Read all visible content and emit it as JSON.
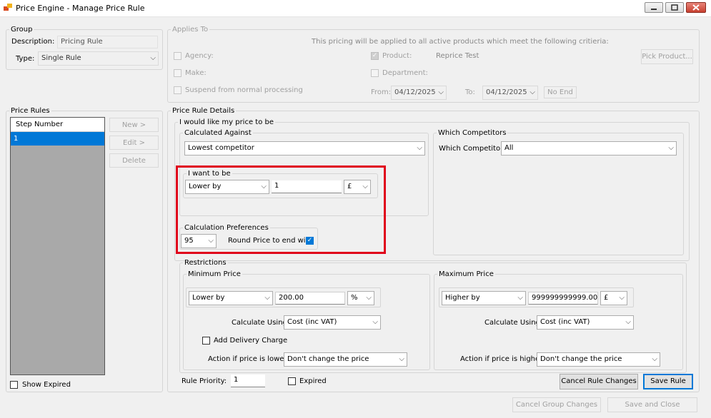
{
  "window": {
    "title": "Price Engine - Manage Price Rule",
    "controls": {
      "minimize": "▭",
      "maximize": "□",
      "close": "✕"
    }
  },
  "group": {
    "legend": "Group",
    "description_label": "Description:",
    "description_value": "Pricing Rule",
    "type_label": "Type:",
    "type_value": "Single Rule"
  },
  "applies_to": {
    "legend": "Applies To",
    "info": "This pricing will be applied to all active products which meet the following critieria:",
    "agency_label": "Agency:",
    "make_label": "Make:",
    "suspend_label": "Suspend from normal processing",
    "product_label": "Product:",
    "product_value": "Reprice Test",
    "pick_product_label": "Pick Product...",
    "department_label": "Department:",
    "from_label": "From:",
    "from_value": "04/12/2025",
    "to_label": "To:",
    "to_value": "04/12/2025",
    "no_end_label": "No End"
  },
  "price_rules": {
    "legend": "Price Rules",
    "column_header": "Step Number",
    "rows": [
      "1"
    ],
    "new_label": "New >",
    "edit_label": "Edit >",
    "delete_label": "Delete",
    "show_expired_label": "Show Expired"
  },
  "details": {
    "legend": "Price Rule Details",
    "like_legend": "I would like my price to be",
    "calc_against_legend": "Calculated Against",
    "calc_against_value": "Lowest competitor",
    "which_competitors_legend": "Which Competitors",
    "which_competitors_label": "Which Competitors:",
    "which_competitors_value": "All",
    "want_legend": "I want to be",
    "want_mode": "Lower by",
    "want_amount": "1",
    "want_unit": "£",
    "calc_prefs_legend": "Calculation Preferences",
    "round_value": "95",
    "round_label": "Round Price to end with",
    "restrictions_legend": "Restrictions",
    "min": {
      "legend": "Minimum Price",
      "mode": "Lower by",
      "amount": "200.00",
      "unit": "%",
      "calc_using_label": "Calculate Using:",
      "calc_using_value": "Cost (inc VAT)",
      "add_delivery_label": "Add Delivery Charge",
      "action_label": "Action if price is lower:",
      "action_value": "Don't change the price"
    },
    "max": {
      "legend": "Maximum Price",
      "mode": "Higher by",
      "amount": "999999999999.00",
      "unit": "£",
      "calc_using_label": "Calculate Using:",
      "calc_using_value": "Cost (inc VAT)",
      "action_label": "Action if price is higher:",
      "action_value": "Don't change the price"
    },
    "priority_label": "Rule Priority:",
    "priority_value": "1",
    "expired_label": "Expired",
    "cancel_rule_label": "Cancel Rule Changes",
    "save_rule_label": "Save Rule"
  },
  "footer": {
    "cancel_group_label": "Cancel Group Changes",
    "save_close_label": "Save and Close"
  },
  "icons": {
    "dropdown": "⌵",
    "check": "✓",
    "app": "price-engine-icon"
  },
  "colors": {
    "highlight_box": "#e0001b",
    "selection": "#0078d7",
    "list_bg": "#a9a9a9"
  }
}
